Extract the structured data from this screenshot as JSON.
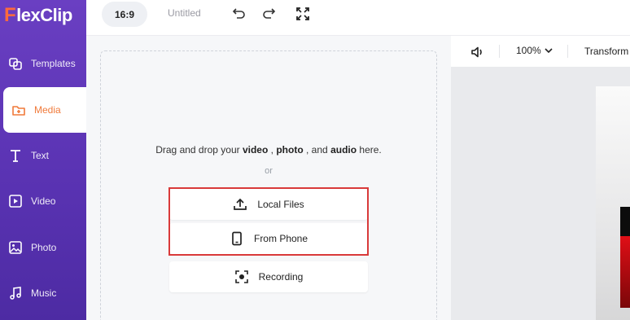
{
  "app": {
    "logo_text": "lexClip",
    "logo_mark": "F"
  },
  "sidebar": {
    "items": [
      {
        "label": "Templates",
        "icon": "templates-icon"
      },
      {
        "label": "Media",
        "icon": "media-folder-icon"
      },
      {
        "label": "Text",
        "icon": "text-icon"
      },
      {
        "label": "Video",
        "icon": "video-icon"
      },
      {
        "label": "Photo",
        "icon": "photo-icon"
      },
      {
        "label": "Music",
        "icon": "music-icon"
      }
    ]
  },
  "topbar": {
    "aspect_ratio": "16:9",
    "project_title": "Untitled"
  },
  "media": {
    "drop_prefix": "Drag and drop your",
    "video": "video",
    "photo": "photo",
    "and": ", and",
    "audio": "audio",
    "suffix": "here.",
    "comma": ",",
    "or": "or",
    "local_files": "Local Files",
    "from_phone": "From Phone",
    "recording": "Recording"
  },
  "preview": {
    "zoom": "100%",
    "transform": "Transform"
  },
  "colors": {
    "sidebar": "#5a33b3",
    "active_accent": "#f07a3a",
    "highlight": "#d93a3a"
  }
}
